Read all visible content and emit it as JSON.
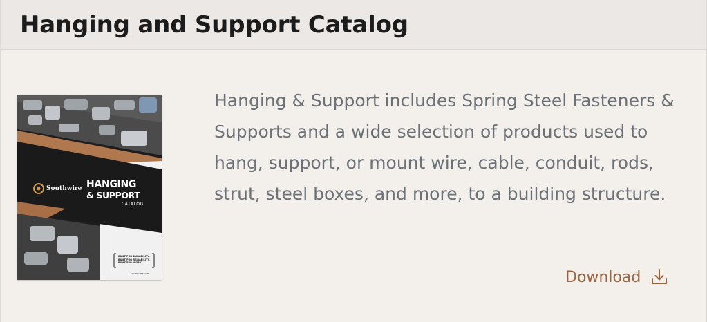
{
  "header": {
    "title": "Hanging and Support Catalog"
  },
  "cover": {
    "brand": "Southwire",
    "title_line1": "HANGING",
    "title_line2": "& SUPPORT",
    "subtitle": "CATALOG",
    "tagline": "BUILT FOR DURABILITY. BUILT FOR RELIABILITY. BUILT FOR WORK.",
    "url": "SOUTHWIRE.COM"
  },
  "description": "Hanging & Support includes Spring Steel Fasteners & Supports and a wide selection of products used to hang, support, or mount wire, cable, conduit, rods, strut, steel boxes, and more, to a building structure.",
  "download": {
    "label": "Download",
    "icon": "download-icon"
  },
  "colors": {
    "background": "#f3efeb",
    "header_background": "#ebe8e5",
    "title_text": "#1c1c1c",
    "body_text": "#6b7177",
    "accent": "#9a6642"
  }
}
